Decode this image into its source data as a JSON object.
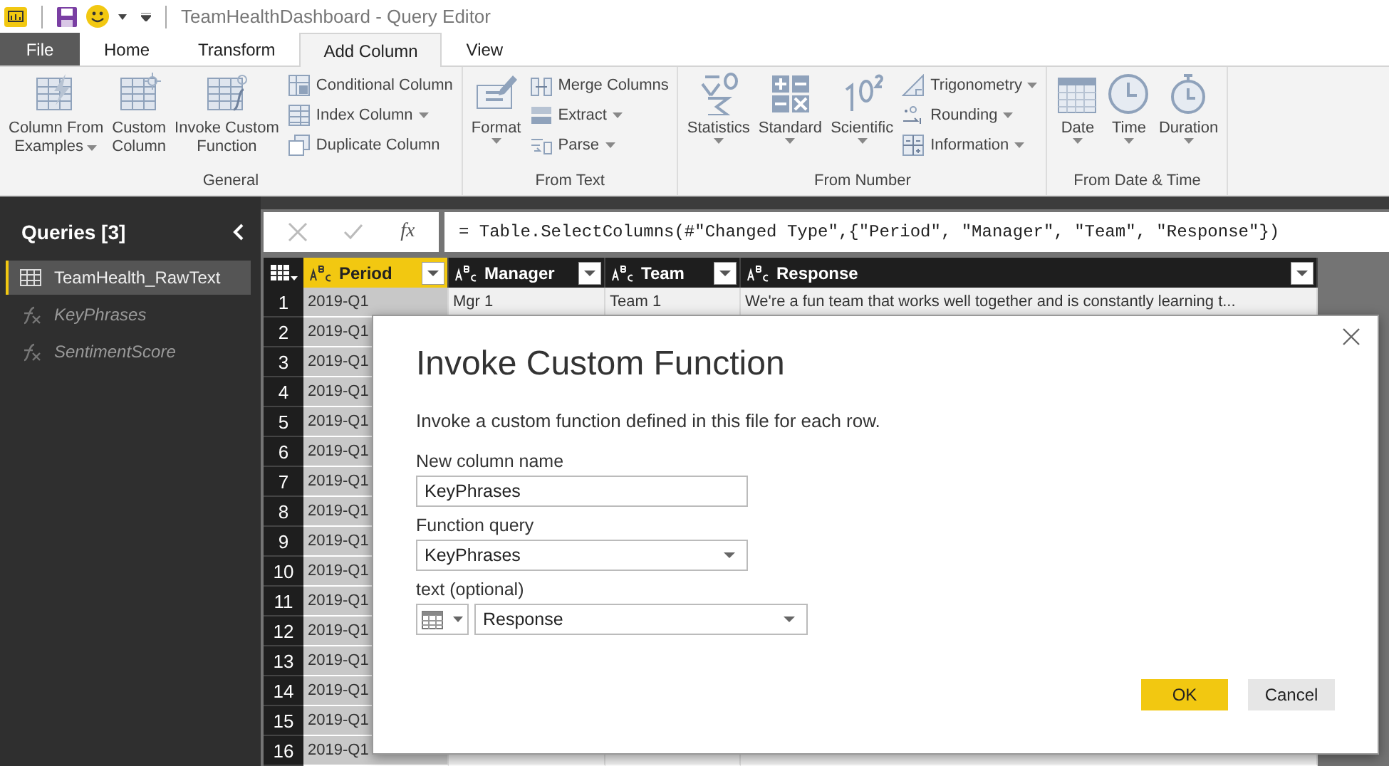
{
  "window": {
    "title": "TeamHealthDashboard - Query Editor"
  },
  "tabs": [
    {
      "label": "File",
      "kind": "file",
      "selected": false
    },
    {
      "label": "Home",
      "kind": "tab",
      "selected": false
    },
    {
      "label": "Transform",
      "kind": "tab",
      "selected": false
    },
    {
      "label": "Add Column",
      "kind": "tab",
      "selected": true
    },
    {
      "label": "View",
      "kind": "tab",
      "selected": false
    }
  ],
  "ribbon": {
    "groups": [
      {
        "label": "General",
        "items": [
          {
            "kind": "large",
            "lines": [
              "Column From",
              "Examples"
            ],
            "dropdown": true
          },
          {
            "kind": "large",
            "lines": [
              "Custom",
              "Column"
            ],
            "dropdown": false
          },
          {
            "kind": "large",
            "lines": [
              "Invoke Custom",
              "Function"
            ],
            "dropdown": false
          },
          {
            "kind": "small",
            "lines": [
              "Conditional Column"
            ],
            "dropdown": false
          },
          {
            "kind": "small",
            "lines": [
              "Index Column"
            ],
            "dropdown": true
          },
          {
            "kind": "small",
            "lines": [
              "Duplicate Column"
            ],
            "dropdown": false
          }
        ]
      },
      {
        "label": "From Text",
        "items": [
          {
            "kind": "large",
            "lines": [
              "Format"
            ],
            "dropdown": true
          },
          {
            "kind": "small",
            "lines": [
              "Merge Columns"
            ],
            "dropdown": false
          },
          {
            "kind": "small",
            "lines": [
              "Extract"
            ],
            "dropdown": true
          },
          {
            "kind": "small",
            "lines": [
              "Parse"
            ],
            "dropdown": true
          }
        ]
      },
      {
        "label": "From Number",
        "items": [
          {
            "kind": "large",
            "lines": [
              "Statistics"
            ],
            "dropdown": true
          },
          {
            "kind": "large",
            "lines": [
              "Standard"
            ],
            "dropdown": true
          },
          {
            "kind": "large",
            "lines": [
              "Scientific"
            ],
            "dropdown": true
          },
          {
            "kind": "small",
            "lines": [
              "Trigonometry"
            ],
            "dropdown": true
          },
          {
            "kind": "small",
            "lines": [
              "Rounding"
            ],
            "dropdown": true
          },
          {
            "kind": "small",
            "lines": [
              "Information"
            ],
            "dropdown": true
          }
        ]
      },
      {
        "label": "From Date & Time",
        "items": [
          {
            "kind": "large",
            "lines": [
              "Date"
            ],
            "dropdown": true
          },
          {
            "kind": "large",
            "lines": [
              "Time"
            ],
            "dropdown": true
          },
          {
            "kind": "large",
            "lines": [
              "Duration"
            ],
            "dropdown": true
          }
        ]
      }
    ]
  },
  "queries": {
    "title": "Queries [3]",
    "items": [
      {
        "label": "TeamHealth_RawText",
        "kind": "table",
        "selected": true
      },
      {
        "label": "KeyPhrases",
        "kind": "function",
        "selected": false
      },
      {
        "label": "SentimentScore",
        "kind": "function",
        "selected": false
      }
    ]
  },
  "formula_bar": {
    "fx": "fx",
    "formula": "= Table.SelectColumns(#\"Changed Type\",{\"Period\", \"Manager\", \"Team\", \"Response\"})"
  },
  "table": {
    "columns": [
      {
        "label": "Period",
        "selected": true
      },
      {
        "label": "Manager",
        "selected": false
      },
      {
        "label": "Team",
        "selected": false
      },
      {
        "label": "Response",
        "selected": false
      }
    ],
    "rows": [
      {
        "number": "1",
        "cells": [
          "2019-Q1",
          "Mgr 1",
          "Team 1",
          "We're a fun team that works well together and is constantly learning t..."
        ]
      },
      {
        "number": "2",
        "cells": [
          "2019-Q1"
        ]
      },
      {
        "number": "3",
        "cells": [
          "2019-Q1"
        ]
      },
      {
        "number": "4",
        "cells": [
          "2019-Q1"
        ]
      },
      {
        "number": "5",
        "cells": [
          "2019-Q1"
        ]
      },
      {
        "number": "6",
        "cells": [
          "2019-Q1"
        ]
      },
      {
        "number": "7",
        "cells": [
          "2019-Q1"
        ]
      },
      {
        "number": "8",
        "cells": [
          "2019-Q1"
        ]
      },
      {
        "number": "9",
        "cells": [
          "2019-Q1"
        ]
      },
      {
        "number": "10",
        "cells": [
          "2019-Q1"
        ]
      },
      {
        "number": "11",
        "cells": [
          "2019-Q1"
        ]
      },
      {
        "number": "12",
        "cells": [
          "2019-Q1"
        ]
      },
      {
        "number": "13",
        "cells": [
          "2019-Q1"
        ]
      },
      {
        "number": "14",
        "cells": [
          "2019-Q1"
        ]
      },
      {
        "number": "15",
        "cells": [
          "2019-Q1"
        ]
      },
      {
        "number": "16",
        "cells": [
          "2019-Q1"
        ]
      }
    ]
  },
  "dialog": {
    "title": "Invoke Custom Function",
    "description": "Invoke a custom function defined in this file for each row.",
    "fields": [
      {
        "kind": "text",
        "label": "New column name",
        "value": "KeyPhrases"
      },
      {
        "kind": "dropdown",
        "label": "Function query",
        "value": "KeyPhrases"
      },
      {
        "kind": "column",
        "label": "text (optional)",
        "value": "Response"
      }
    ],
    "buttons": [
      {
        "label": "OK",
        "kind": "primary"
      },
      {
        "label": "Cancel",
        "kind": "secondary"
      }
    ]
  }
}
